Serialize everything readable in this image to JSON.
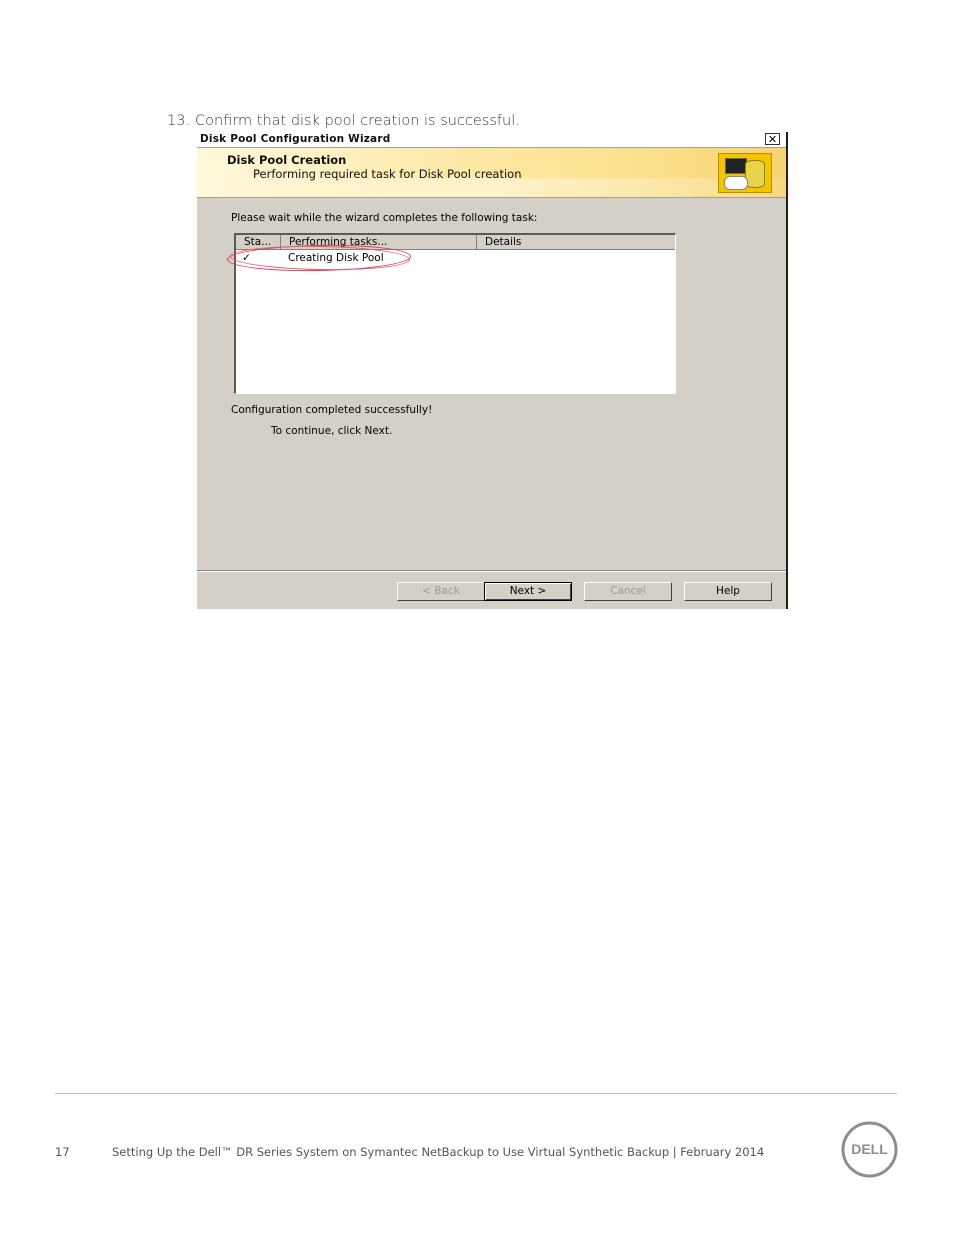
{
  "step": {
    "number": "13.",
    "text": "Confirm that disk pool creation is successful."
  },
  "wizard": {
    "title": "Disk Pool Configuration Wizard",
    "close_glyph": "✕",
    "banner": {
      "heading": "Disk Pool Creation",
      "subheading": "Performing required task for Disk Pool creation",
      "icon": "disk-pool-icon"
    },
    "instruction": "Please wait while the wizard completes the following task:",
    "task_list": {
      "columns": [
        "Sta...",
        "Performing tasks...",
        "Details"
      ],
      "rows": [
        {
          "status": "✓",
          "task": "Creating Disk Pool",
          "details": ""
        }
      ]
    },
    "status_message": "Configuration completed successfully!",
    "continue_message": "To continue, click Next.",
    "buttons": {
      "back": "< Back",
      "next": "Next >",
      "cancel": "Cancel",
      "help": "Help"
    },
    "highlight_color": "#d63a4a"
  },
  "footer": {
    "page_number": "17",
    "text": "Setting Up the Dell™ DR Series System on Symantec NetBackup to Use Virtual Synthetic Backup | February 2014",
    "logo_text": "DELL"
  }
}
